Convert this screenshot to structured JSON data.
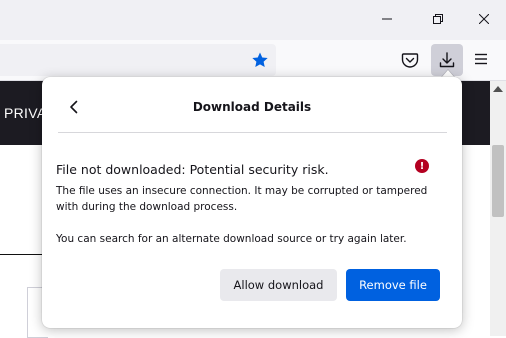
{
  "window": {
    "minimize_icon": "minimize-icon",
    "restore_icon": "restore-icon",
    "close_icon": "close-icon"
  },
  "toolbar": {
    "bookmark_icon": "star-icon",
    "pocket_icon": "pocket-icon",
    "downloads_icon": "download-icon",
    "menu_icon": "hamburger-menu-icon"
  },
  "page": {
    "header_text": "PRIVA"
  },
  "panel": {
    "title": "Download Details",
    "heading": "File not downloaded: Potential security risk.",
    "description": "The file uses an insecure connection. It may be corrupted or tampered with during the download process.",
    "hint": "You can search for an alternate download source or try again later.",
    "allow_label": "Allow download",
    "remove_label": "Remove file",
    "error_glyph": "!"
  },
  "colors": {
    "accent": "#0061e0",
    "error": "#b40021",
    "star": "#0061e0",
    "header_dark": "#1c1b22"
  }
}
